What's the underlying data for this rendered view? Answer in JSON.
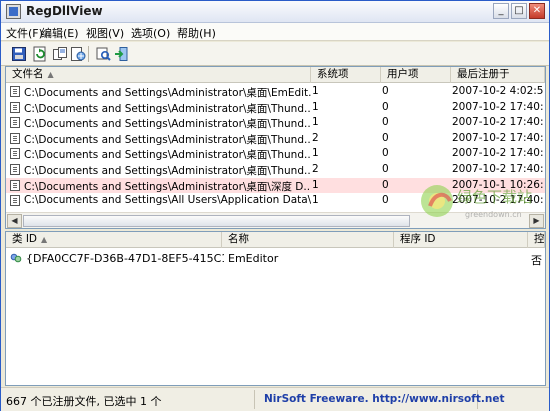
{
  "window": {
    "title": "RegDllView",
    "buttons": {
      "minimize": "_",
      "maximize": "□",
      "close": "✕"
    }
  },
  "menu": [
    "文件(F)",
    "编辑(E)",
    "视图(V)",
    "选项(O)",
    "帮助(H)"
  ],
  "toolbar": {
    "icons": [
      "save-icon",
      "refresh-icon",
      "copy-icon",
      "html-report-icon",
      "properties-icon",
      "exit-icon"
    ]
  },
  "top_table": {
    "columns": [
      "文件名",
      "系统项",
      "用户项",
      "最后注册于"
    ],
    "sort_arrow": "▲",
    "rows": [
      {
        "file": "C:\\Documents and Settings\\Administrator\\桌面\\EmEdit...",
        "system": "1",
        "user": "0",
        "date": "2007-10-2 4:02:5"
      },
      {
        "file": "C:\\Documents and Settings\\Administrator\\桌面\\Thund...",
        "system": "1",
        "user": "0",
        "date": "2007-10-2 17:40:"
      },
      {
        "file": "C:\\Documents and Settings\\Administrator\\桌面\\Thund...",
        "system": "1",
        "user": "0",
        "date": "2007-10-2 17:40:"
      },
      {
        "file": "C:\\Documents and Settings\\Administrator\\桌面\\Thund...",
        "system": "2",
        "user": "0",
        "date": "2007-10-2 17:40:"
      },
      {
        "file": "C:\\Documents and Settings\\Administrator\\桌面\\Thund...",
        "system": "1",
        "user": "0",
        "date": "2007-10-2 17:40:"
      },
      {
        "file": "C:\\Documents and Settings\\Administrator\\桌面\\Thund...",
        "system": "2",
        "user": "0",
        "date": "2007-10-2 17:40:"
      },
      {
        "file": "C:\\Documents and Settings\\Administrator\\桌面\\深度 D...",
        "system": "1",
        "user": "0",
        "date": "2007-10-1 10:26:"
      },
      {
        "file": "C:\\Documents and Settings\\All Users\\Application Data\\...",
        "system": "1",
        "user": "0",
        "date": "2007-10-2 17:40:"
      }
    ]
  },
  "bottom_table": {
    "columns": [
      "类 ID",
      "名称",
      "程序 ID",
      "控件"
    ],
    "sort_arrow": "▲",
    "row": {
      "class_id": "{DFA0CC7F-D36B-47D1-8EF5-415C1D...",
      "name": "EmEditor",
      "program_id": "",
      "control": "否"
    }
  },
  "status": {
    "left": "667 个已注册文件, 已选中 1 个",
    "right": "NirSoft Freeware.  http://www.nirsoft.net"
  },
  "watermark": {
    "logo_text": "绿色下载站",
    "site_text": "greendown.cn"
  }
}
